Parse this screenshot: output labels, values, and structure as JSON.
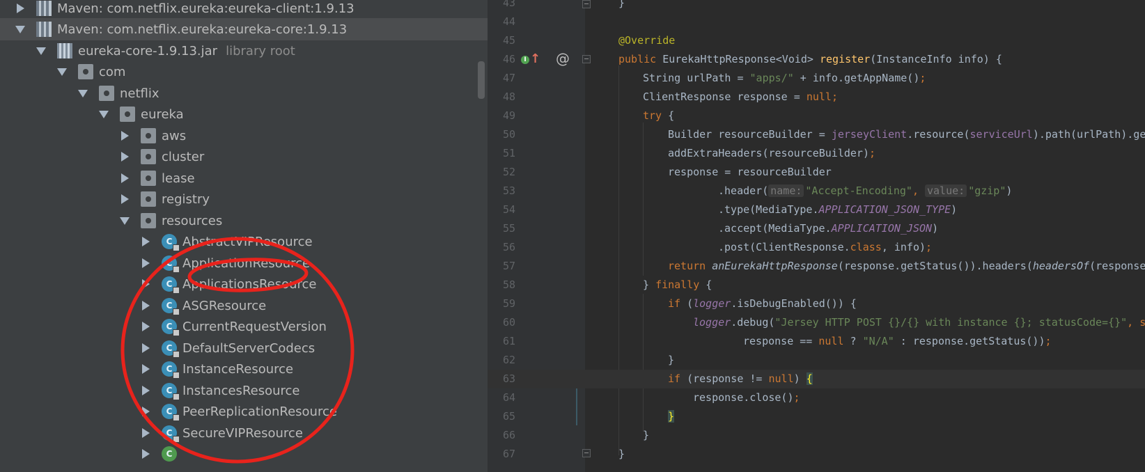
{
  "project_tree": {
    "items": [
      {
        "label": "Maven: com.netflix.eureka:eureka-client:1.9.13",
        "icon": "library-icon",
        "expanded": false
      },
      {
        "label": "Maven: com.netflix.eureka:eureka-core:1.9.13",
        "icon": "library-icon",
        "expanded": true
      },
      {
        "label": "eureka-core-1.9.13.jar",
        "sublabel": "library root",
        "icon": "jar-icon",
        "expanded": true
      },
      {
        "label": "com",
        "icon": "package-icon",
        "expanded": true
      },
      {
        "label": "netflix",
        "icon": "package-icon",
        "expanded": true
      },
      {
        "label": "eureka",
        "icon": "package-icon",
        "expanded": true
      },
      {
        "label": "aws",
        "icon": "package-icon",
        "expanded": false
      },
      {
        "label": "cluster",
        "icon": "package-icon",
        "expanded": false
      },
      {
        "label": "lease",
        "icon": "package-icon",
        "expanded": false
      },
      {
        "label": "registry",
        "icon": "package-icon",
        "expanded": false
      },
      {
        "label": "resources",
        "icon": "package-icon",
        "expanded": true
      },
      {
        "label": "AbstractVIPResource",
        "icon": "class-icon",
        "expanded": false
      },
      {
        "label": "ApplicationResource",
        "icon": "class-icon",
        "expanded": false
      },
      {
        "label": "ApplicationsResource",
        "icon": "class-icon",
        "expanded": false
      },
      {
        "label": "ASGResource",
        "icon": "class-icon",
        "expanded": false
      },
      {
        "label": "CurrentRequestVersion",
        "icon": "class-icon",
        "expanded": false
      },
      {
        "label": "DefaultServerCodecs",
        "icon": "class-icon",
        "expanded": false
      },
      {
        "label": "InstanceResource",
        "icon": "class-icon",
        "expanded": false
      },
      {
        "label": "InstancesResource",
        "icon": "class-icon",
        "expanded": false
      },
      {
        "label": "PeerReplicationResource",
        "icon": "class-icon",
        "expanded": false
      },
      {
        "label": "SecureVIPResource",
        "icon": "class-icon",
        "expanded": false
      }
    ]
  },
  "editor": {
    "line_numbers": [
      "43",
      "44",
      "45",
      "46",
      "47",
      "48",
      "49",
      "50",
      "51",
      "52",
      "53",
      "54",
      "55",
      "56",
      "57",
      "58",
      "59",
      "60",
      "61",
      "62",
      "63",
      "64",
      "65",
      "66",
      "67"
    ],
    "current_line": "63",
    "param_hints": {
      "name": "name:",
      "value": "value:"
    },
    "gutter_icons": [
      "implementation-icon",
      "override-up-arrow-icon",
      "annotation-at-icon",
      "fold-icon"
    ],
    "code": {
      "l43": "}",
      "l45_annotation": "@Override",
      "l46_kw": "public",
      "l46_type": "EurekaHttpResponse<Void>",
      "l46_method": "register",
      "l46_params": "(InstanceInfo info) {",
      "l47_a": "String urlPath = ",
      "l47_str": "\"apps/\"",
      "l47_b": " + info.getAppName()",
      "l47_semi": ";",
      "l48_a": "ClientResponse response = ",
      "l48_null": "null",
      "l48_semi": ";",
      "l49_kw": "try",
      "l49_b": " {",
      "l50_a": "Builder resourceBuilder = ",
      "l50_field1": "jerseyClient",
      "l50_b": ".resource(",
      "l50_field2": "serviceUrl",
      "l50_c": ").path(urlPath).ge",
      "l51_a": "addExtraHeaders(resourceBuilder)",
      "l51_semi": ";",
      "l52": "response = resourceBuilder",
      "l53_a": ".header(",
      "l53_str1": "\"Accept-Encoding\"",
      "l53_comma": ", ",
      "l53_str2": "\"gzip\"",
      "l53_b": ")",
      "l54_a": ".type(MediaType.",
      "l54_const": "APPLICATION_JSON_TYPE",
      "l54_b": ")",
      "l55_a": ".accept(MediaType.",
      "l55_const": "APPLICATION_JSON",
      "l55_b": ")",
      "l56_a": ".post(ClientResponse.",
      "l56_kw": "class",
      "l56_b": ", info)",
      "l56_semi": ";",
      "l57_kw": "return ",
      "l57_m": "anEurekaHttpResponse",
      "l57_b": "(response.getStatus()).headers(",
      "l57_m2": "headersOf",
      "l57_c": "(response",
      "l58_a": "} ",
      "l58_kw": "finally",
      "l58_b": " {",
      "l59_kw": "if",
      "l59_a": " (",
      "l59_field": "logger",
      "l59_b": ".isDebugEnabled()) {",
      "l60_field": "logger",
      "l60_a": ".debug(",
      "l60_str": "\"Jersey HTTP POST {}/{} with instance {}; statusCode={}\"",
      "l60_b": ", s",
      "l61_a": "response == ",
      "l61_null": "null",
      "l61_b": " ? ",
      "l61_str": "\"N/A\"",
      "l61_c": " : response.getStatus())",
      "l61_semi": ";",
      "l62": "}",
      "l63_kw": "if",
      "l63_a": " (response != ",
      "l63_null": "null",
      "l63_b": ") ",
      "l63_brace": "{",
      "l64_a": "response.close()",
      "l64_semi": ";",
      "l65_brace": "}",
      "l66": "}",
      "l67": "}"
    }
  },
  "colors": {
    "tree_bg": "#3c3f41",
    "editor_bg": "#2b2b2b",
    "gutter_bg": "#313335",
    "keyword": "#cc7832",
    "string": "#6a8759",
    "annotation": "#bbb529",
    "field": "#9876aa",
    "method_decl": "#ffc66d",
    "annotation_circle": "#e8231c"
  }
}
